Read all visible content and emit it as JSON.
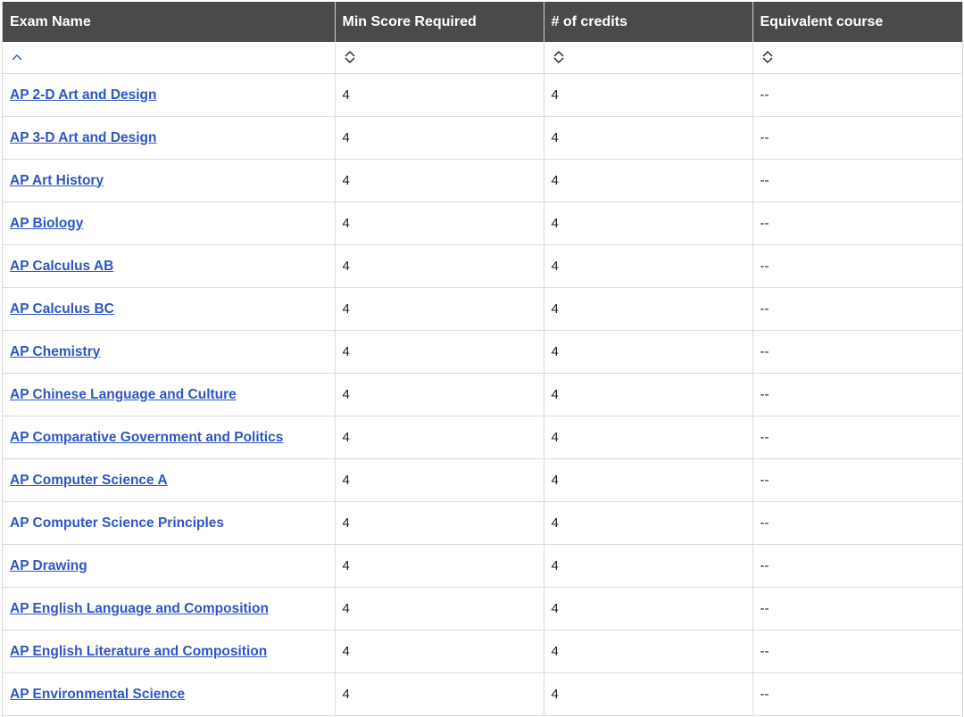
{
  "table": {
    "headers": [
      "Exam Name",
      "Min Score Required",
      "# of credits",
      "Equivalent course"
    ],
    "sort_icons": [
      "sort-ascending-icon",
      "sort-both-icon",
      "sort-both-icon",
      "sort-both-icon"
    ],
    "rows": [
      {
        "exam": "AP 2-D Art and Design",
        "min_score": "4",
        "credits": "4",
        "equivalent": "--",
        "underlined": true
      },
      {
        "exam": "AP 3-D Art and Design",
        "min_score": "4",
        "credits": "4",
        "equivalent": "--",
        "underlined": true
      },
      {
        "exam": "AP Art History",
        "min_score": "4",
        "credits": "4",
        "equivalent": "--",
        "underlined": true
      },
      {
        "exam": "AP Biology",
        "min_score": "4",
        "credits": "4",
        "equivalent": "--",
        "underlined": true
      },
      {
        "exam": "AP Calculus AB",
        "min_score": "4",
        "credits": "4",
        "equivalent": "--",
        "underlined": true
      },
      {
        "exam": "AP Calculus BC",
        "min_score": "4",
        "credits": "4",
        "equivalent": "--",
        "underlined": true
      },
      {
        "exam": "AP Chemistry",
        "min_score": "4",
        "credits": "4",
        "equivalent": "--",
        "underlined": true
      },
      {
        "exam": "AP Chinese Language and Culture",
        "min_score": "4",
        "credits": "4",
        "equivalent": "--",
        "underlined": true
      },
      {
        "exam": "AP Comparative Government and Politics",
        "min_score": "4",
        "credits": "4",
        "equivalent": "--",
        "underlined": true
      },
      {
        "exam": "AP Computer Science A",
        "min_score": "4",
        "credits": "4",
        "equivalent": "--",
        "underlined": true
      },
      {
        "exam": "AP Computer Science Principles",
        "min_score": "4",
        "credits": "4",
        "equivalent": "--",
        "underlined": false
      },
      {
        "exam": "AP Drawing",
        "min_score": "4",
        "credits": "4",
        "equivalent": "--",
        "underlined": true
      },
      {
        "exam": "AP English Language and Composition",
        "min_score": "4",
        "credits": "4",
        "equivalent": "--",
        "underlined": true
      },
      {
        "exam": "AP English Literature and Composition",
        "min_score": "4",
        "credits": "4",
        "equivalent": "--",
        "underlined": true
      },
      {
        "exam": "AP Environmental Science",
        "min_score": "4",
        "credits": "4",
        "equivalent": "--",
        "underlined": true
      }
    ]
  },
  "colors": {
    "header_bg": "#4b4a48",
    "link": "#2f55c5",
    "sort_active": "#2f55c5",
    "sort_inactive": "#222222"
  }
}
